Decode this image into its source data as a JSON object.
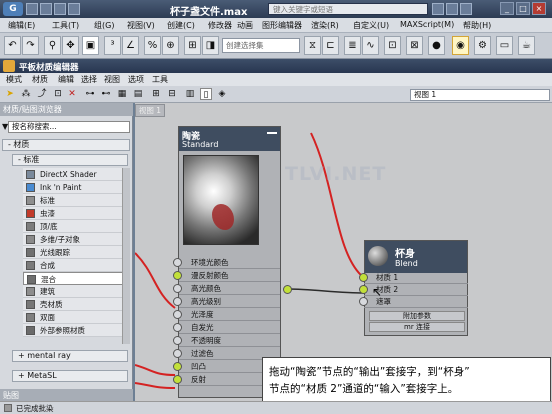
{
  "app": {
    "logo": "G",
    "title": "杯子盏文件.max",
    "search_placeholder": "键入关键字或短语",
    "window_buttons": [
      "_",
      "□",
      "×"
    ]
  },
  "main_menu": [
    "编辑(E)",
    "工具(T)",
    "组(G)",
    "视图(V)",
    "创建(C)",
    "修改器",
    "动画",
    "图形编辑器",
    "渲染(R)",
    "自定义(U)",
    "MAXScript(M)",
    "帮助(H)"
  ],
  "toolbar": {
    "selection_set_placeholder": "创建选择集"
  },
  "sme": {
    "title": "平板材质编辑器",
    "menu": [
      "模式",
      "材质",
      "编辑",
      "选择",
      "视图",
      "选项",
      "工具"
    ],
    "view_dropdown": "视图 1",
    "view_tab": "视图 1"
  },
  "browser": {
    "header": "材质/贴图浏览器",
    "search_placeholder": "按名称搜索...",
    "group_materials": "- 材质",
    "group_standard": "- 标准",
    "items": [
      {
        "label": "DirectX Shader",
        "color": "#7b8a9c"
      },
      {
        "label": "Ink 'n Paint",
        "color": "#4a8bd1"
      },
      {
        "label": "标准",
        "color": "#8e8e8e"
      },
      {
        "label": "虫漆",
        "color": "#c23a2a"
      },
      {
        "label": "顶/底",
        "color": "#7d7d7d"
      },
      {
        "label": "多维/子对象",
        "color": "#8a8a8a"
      },
      {
        "label": "光线跟踪",
        "color": "#707070"
      },
      {
        "label": "合成",
        "color": "#7b7b7b"
      },
      {
        "label": "混合",
        "color": "#6e6e6e"
      },
      {
        "label": "建筑",
        "color": "#8d8d8d"
      },
      {
        "label": "壳材质",
        "color": "#777777"
      },
      {
        "label": "双面",
        "color": "#7f7f7f"
      },
      {
        "label": "外部参照材质",
        "color": "#6a6a6a"
      }
    ],
    "selected_item": "混合",
    "group_mental_ray": "+ mental ray",
    "group_metasl": "+ MetaSL",
    "bottom_header": "贴图"
  },
  "node_porcelain": {
    "name": "陶瓷",
    "type": "Standard",
    "slots": [
      "环境光颜色",
      "漫反射颜色",
      "高光颜色",
      "高光级别",
      "光泽度",
      "自发光",
      "不透明度",
      "过滤色",
      "凹凸",
      "反射"
    ]
  },
  "node_cup": {
    "name": "杯身",
    "type": "Blend",
    "slots": [
      "材质 1",
      "材质 2",
      "遮罩"
    ],
    "rollouts": [
      "附加参数",
      "mr 连接"
    ]
  },
  "watermark": "TLVI.NET",
  "callout": {
    "line1": "拖动“陶瓷”节点的“输出”套接字，到“杯身”",
    "line2": "节点的“材质 2”通道的“输入”套接字上。"
  },
  "status": "已完成批染"
}
